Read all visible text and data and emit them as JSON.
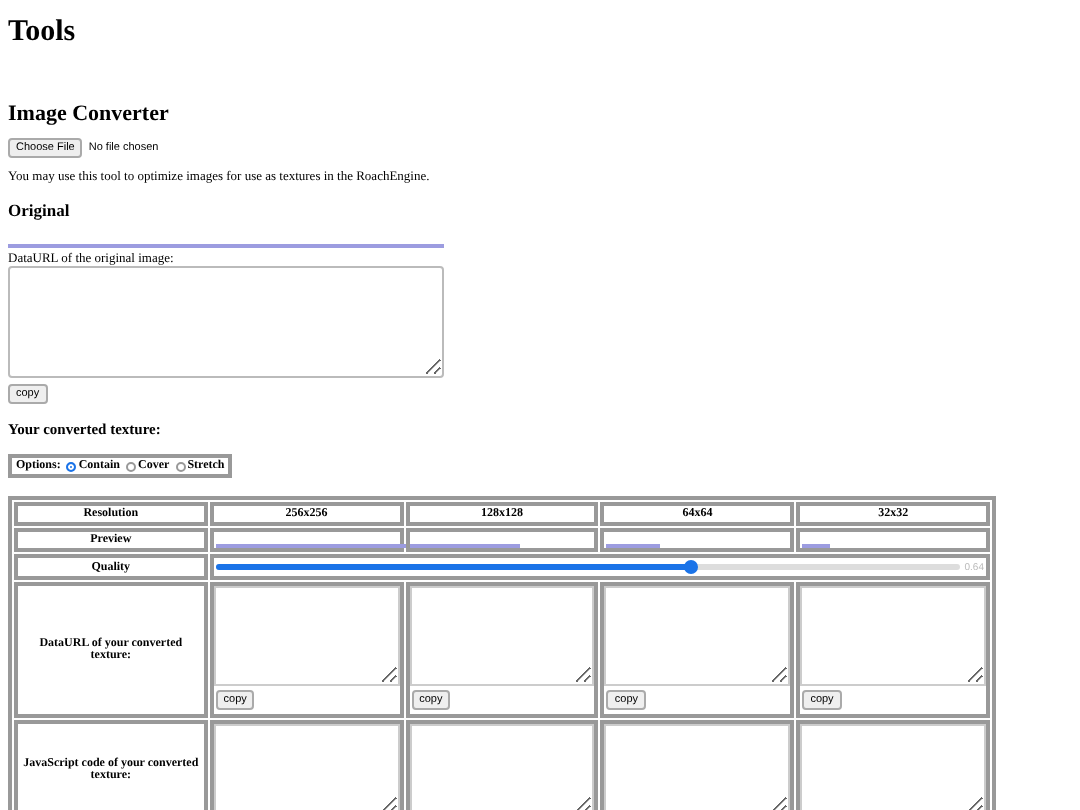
{
  "page_title": "Tools",
  "converter": {
    "title": "Image Converter",
    "file_button": "Choose File",
    "file_status": "No file chosen",
    "description": "You may use this tool to optimize images for use as textures in the RoachEngine."
  },
  "original": {
    "title": "Original",
    "dataurl_label": "DataURL of the original image:",
    "copy_button": "copy"
  },
  "converted": {
    "title": "Your converted texture:",
    "options_label": "Options:",
    "options": [
      {
        "label": "Contain",
        "selected": true
      },
      {
        "label": "Cover",
        "selected": false
      },
      {
        "label": "Stretch",
        "selected": false
      }
    ]
  },
  "table": {
    "row_headers": [
      "Resolution",
      "Preview",
      "Quality",
      "DataURL of your converted texture:",
      "JavaScript code of your converted texture:"
    ],
    "resolutions": [
      "256x256",
      "128x128",
      "64x64",
      "32x32"
    ],
    "quality": {
      "level": 0.64,
      "reading": "0.64"
    },
    "copy_buttons": [
      "copy",
      "copy",
      "copy",
      "copy"
    ]
  }
}
